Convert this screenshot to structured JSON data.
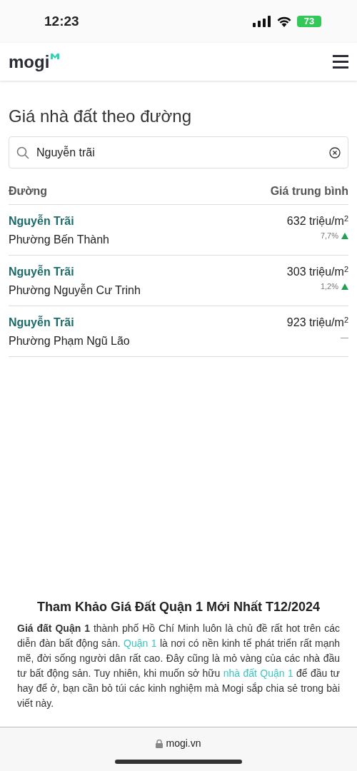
{
  "status_bar": {
    "time": "12:23",
    "battery": "73"
  },
  "header": {
    "logo": "mogi"
  },
  "page_title": "Giá nhà đất theo đường",
  "search": {
    "value": "Nguyễn trãi"
  },
  "table": {
    "columns": [
      "Đường",
      "Giá trung bình"
    ],
    "rows": [
      {
        "street": "Nguyễn Trãi",
        "ward": "Phường Bến Thành",
        "price": "632 triệu/m",
        "unit_power": "2",
        "change": "7,7%",
        "rising": true
      },
      {
        "street": "Nguyễn Trãi",
        "ward": "Phường Nguyễn Cư Trinh",
        "price": "303 triệu/m",
        "unit_power": "2",
        "change": "1,2%",
        "rising": true
      },
      {
        "street": "Nguyễn Trãi",
        "ward": "Phường Phạm Ngũ Lão",
        "price": "923 triệu/m",
        "unit_power": "2",
        "rising": false,
        "flat_mark": "—"
      }
    ]
  },
  "article": {
    "title": "Tham Khảo Giá Đất Quận 1 Mới Nhất T12/2024",
    "paragraph": [
      {
        "kind": "text",
        "text": "**Giá đất Quận 1** thành phố Hồ Chí Minh luôn là chủ đề rất hot trên các diễn đàn bất động sản. "
      },
      {
        "kind": "link",
        "text": "Quận 1"
      },
      {
        "kind": "text",
        "text": " là nơi có nền kinh tế phát triển rất mạnh mẽ, đời sống người dân rất cao. Đây cũng là mỏ vàng của các nhà đầu tư bất động sản. Tuy nhiên, khi muốn sở hữu "
      },
      {
        "kind": "link",
        "text": "nhà đất Quận 1"
      },
      {
        "kind": "text",
        "text": " để đầu tư hay để ở, bạn cần bỏ túi các kinh nghiệm mà Mogi sắp chia sẻ trong bài viết này."
      }
    ]
  },
  "browser_bar": {
    "url": "mogi.vn"
  }
}
